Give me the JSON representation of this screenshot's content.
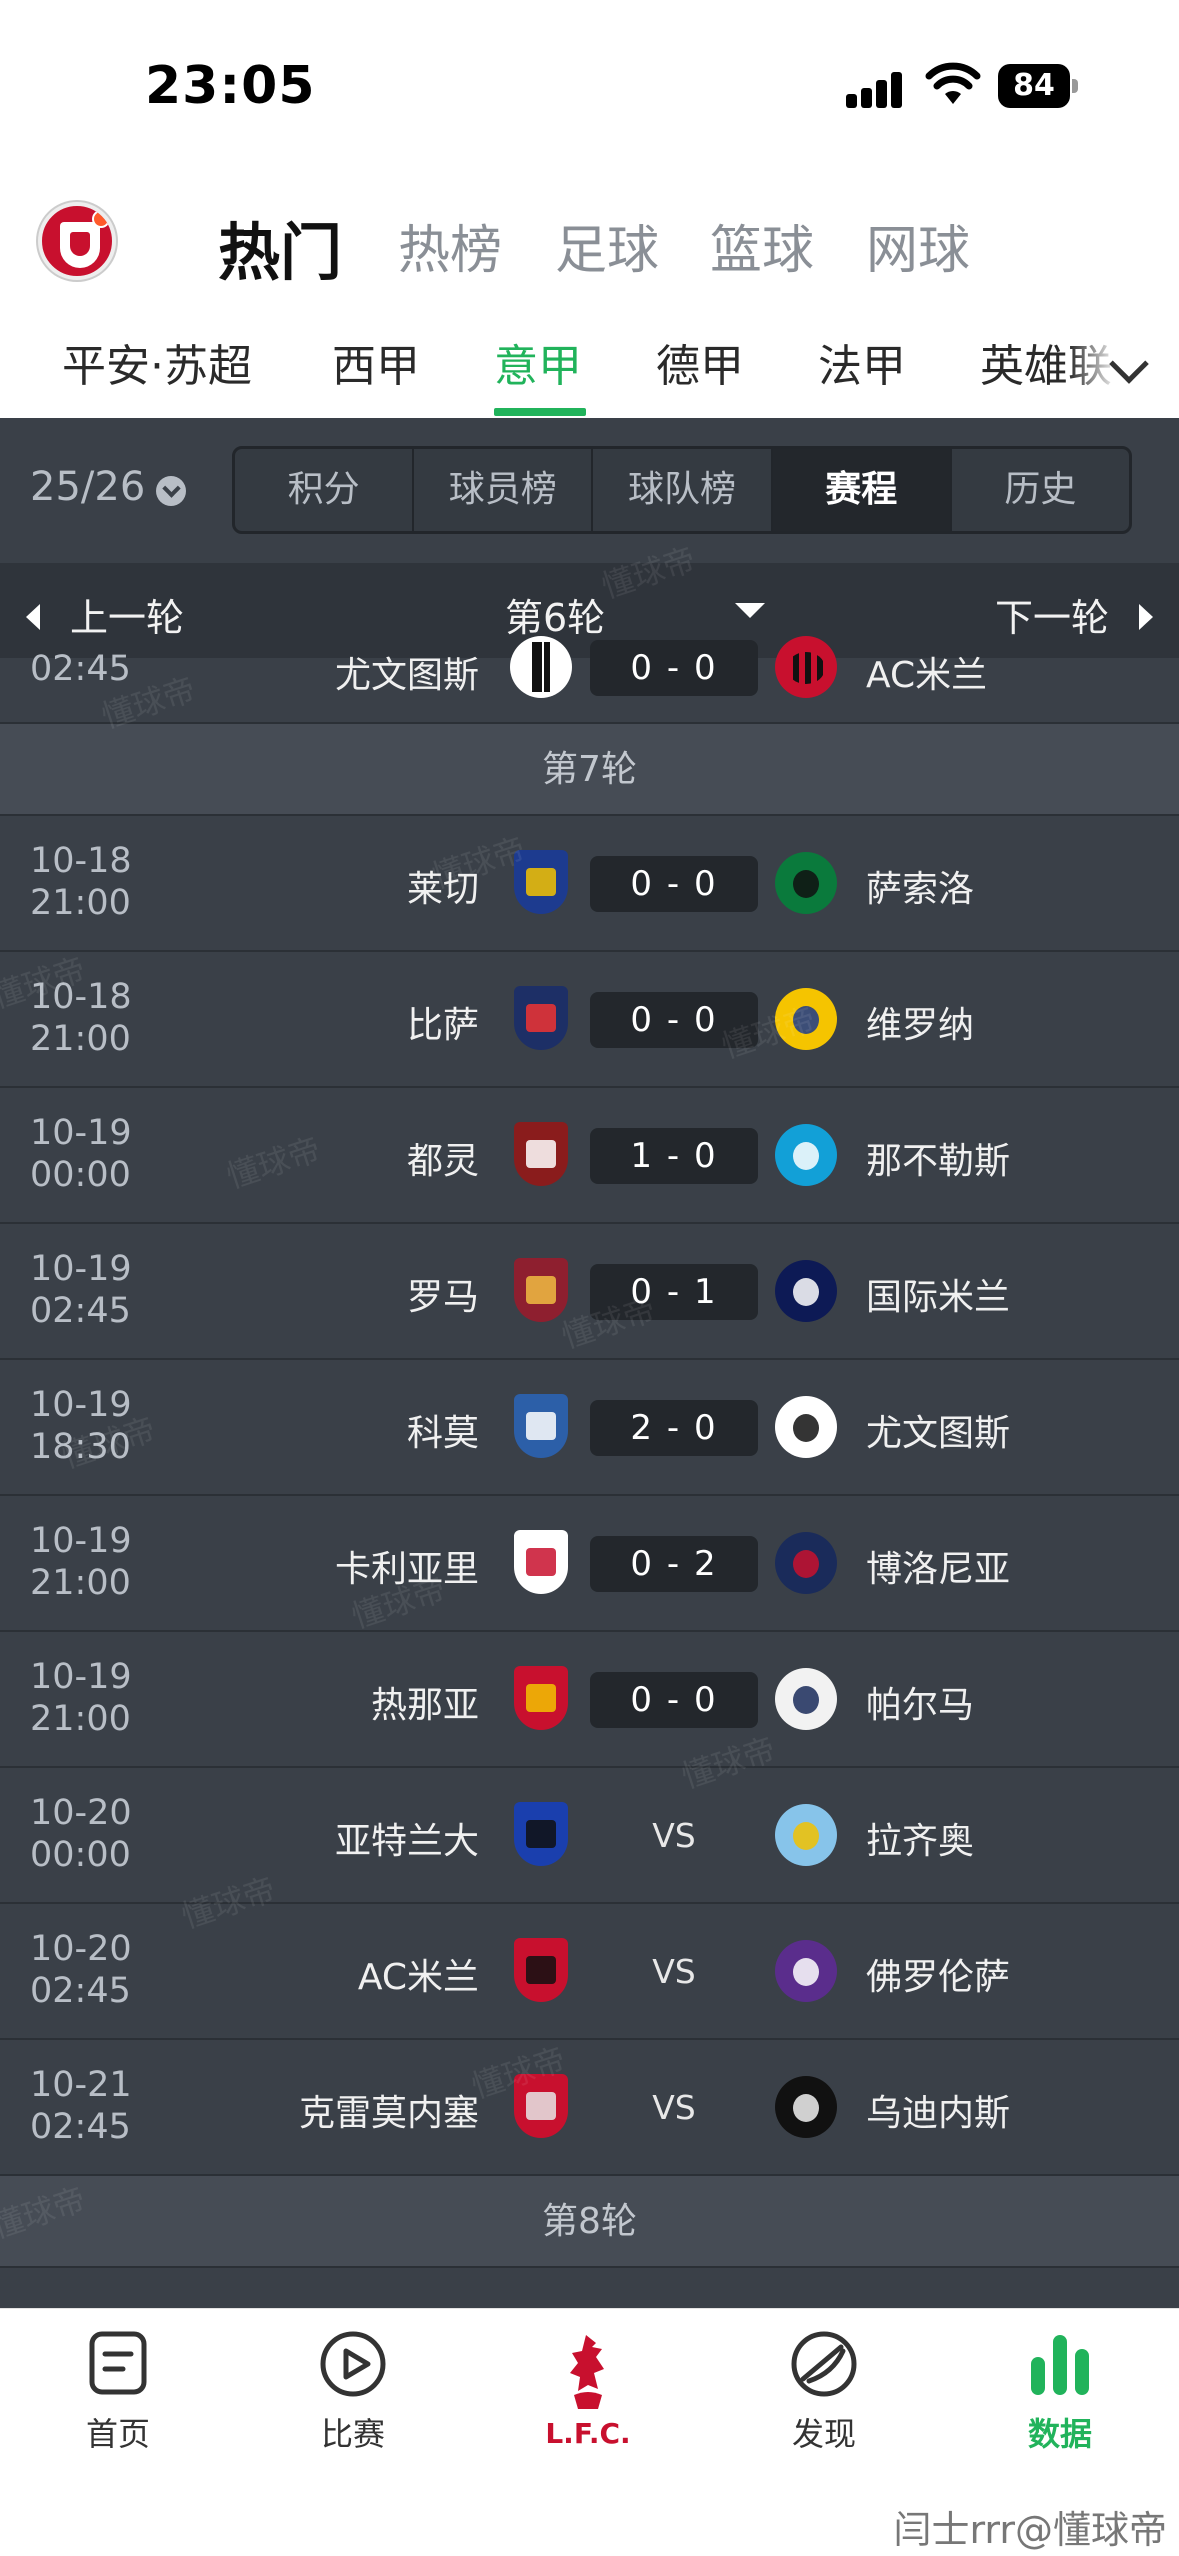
{
  "status": {
    "time": "23:05",
    "battery": "84"
  },
  "top_tabs": [
    "热门",
    "热榜",
    "足球",
    "篮球",
    "网球"
  ],
  "league_tabs": [
    "平安·苏超",
    "西甲",
    "意甲",
    "德甲",
    "法甲",
    "英雄联"
  ],
  "season": "25/26",
  "segments": [
    "积分",
    "球员榜",
    "球队榜",
    "赛程",
    "历史"
  ],
  "round_nav": {
    "prev": "上一轮",
    "current": "第6轮",
    "next": "下一轮"
  },
  "partial_top": {
    "time": "02:45",
    "home": "尤文图斯",
    "score": "0 - 0",
    "away": "AC米兰"
  },
  "round7": {
    "label": "第7轮"
  },
  "matches": [
    {
      "date": "10-18",
      "time": "21:00",
      "home": "莱切",
      "score": "0 - 0",
      "away": "萨索洛"
    },
    {
      "date": "10-18",
      "time": "21:00",
      "home": "比萨",
      "score": "0 - 0",
      "away": "维罗纳"
    },
    {
      "date": "10-19",
      "time": "00:00",
      "home": "都灵",
      "score": "1 - 0",
      "away": "那不勒斯"
    },
    {
      "date": "10-19",
      "time": "02:45",
      "home": "罗马",
      "score": "0 - 1",
      "away": "国际米兰"
    },
    {
      "date": "10-19",
      "time": "18:30",
      "home": "科莫",
      "score": "2 - 0",
      "away": "尤文图斯"
    },
    {
      "date": "10-19",
      "time": "21:00",
      "home": "卡利亚里",
      "score": "0 - 2",
      "away": "博洛尼亚"
    },
    {
      "date": "10-19",
      "time": "21:00",
      "home": "热那亚",
      "score": "0 - 0",
      "away": "帕尔马"
    },
    {
      "date": "10-20",
      "time": "00:00",
      "home": "亚特兰大",
      "score": "VS",
      "away": "拉齐奥"
    },
    {
      "date": "10-20",
      "time": "02:45",
      "home": "AC米兰",
      "score": "VS",
      "away": "佛罗伦萨"
    },
    {
      "date": "10-21",
      "time": "02:45",
      "home": "克雷莫内塞",
      "score": "VS",
      "away": "乌迪内斯"
    }
  ],
  "round8": {
    "label": "第8轮"
  },
  "watermark_text": "懂球帝",
  "bottom_nav": [
    "首页",
    "比赛",
    "L.F.C.",
    "发现",
    "数据"
  ],
  "credit": "闫士rrr@懂球帝",
  "colors": {
    "accent_green": "#21b35b",
    "dark_bg": "#3a4048",
    "score_box": "#23272c",
    "lfc_red": "#c8102e"
  }
}
